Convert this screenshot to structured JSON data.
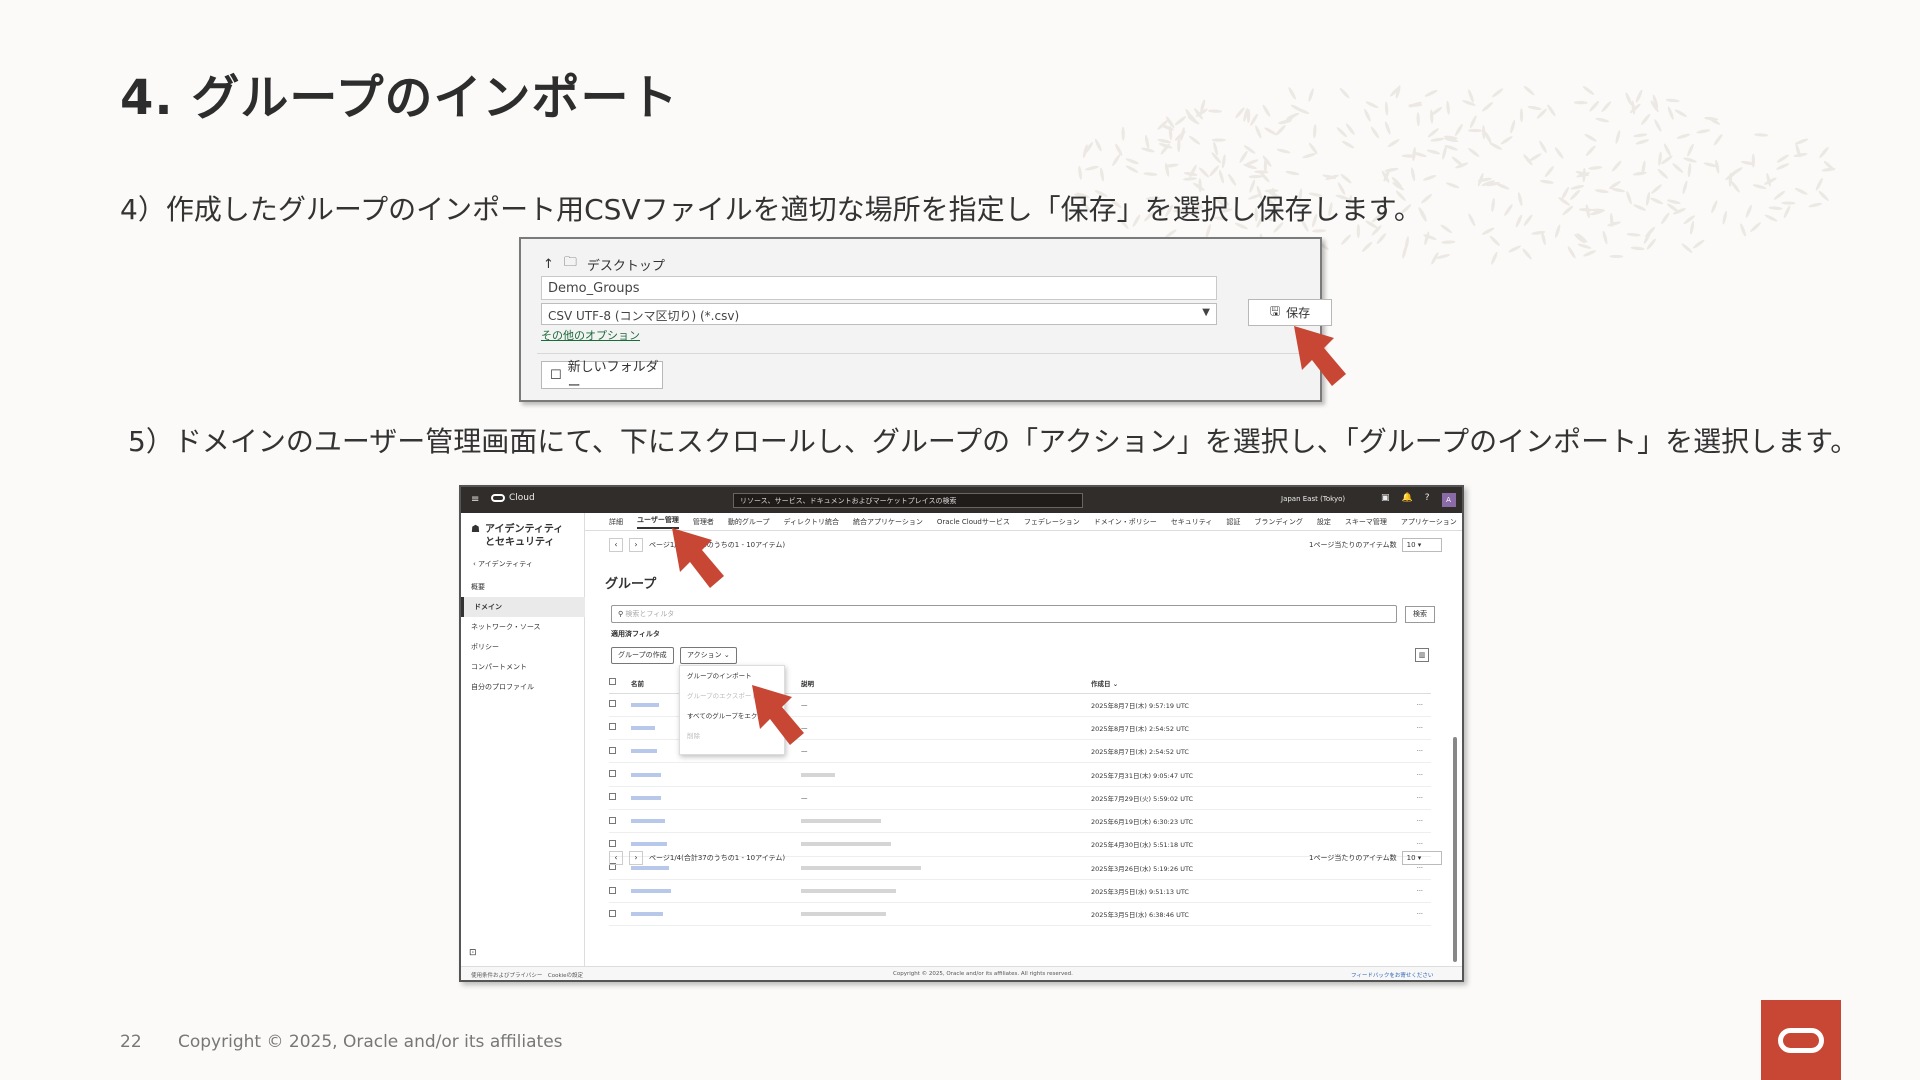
{
  "slide": {
    "title": "4. グループのインポート",
    "step4": "4）作成したグループのインポート用CSVファイルを適切な場所を指定し「保存」を選択し保存します。",
    "step5": "5）ドメインのユーザー管理画面にて、下にスクロールし、グループの「アクション」を選択し、「グループのインポート」を選択します。",
    "page_number": "22",
    "copyright": "Copyright © 2025, Oracle and/or its affiliates",
    "accent_color": "#c74634"
  },
  "save_dialog": {
    "up_symbol": "↑",
    "folder_symbol": "🗀",
    "location": "デスクトップ",
    "file_name": "Demo_Groups",
    "file_type": "CSV UTF-8 (コンマ区切り) (*.csv)",
    "dropdown_symbol": "▼",
    "more_options": "その他のオプション",
    "save_symbol": "🖫",
    "save_label": "保存",
    "new_folder_symbol": "☐",
    "new_folder_label": "新しいフォルダー"
  },
  "oci": {
    "topbar": {
      "menu_symbol": "≡",
      "brand": "Cloud",
      "search_placeholder": "リソース、サービス、ドキュメントおよびマーケットプレイスの検索",
      "region": "Japan East (Tokyo)",
      "icons": [
        "▣",
        "🔔",
        "?"
      ],
      "avatar": "A"
    },
    "sidebar": {
      "icon": "☗",
      "heading": "アイデンティティとセキュリティ",
      "back": "‹  アイデンティティ",
      "items": [
        "概要",
        "ドメイン",
        "ネットワーク・ソース",
        "ポリシー",
        "コンパートメント",
        "自分のプロファイル"
      ],
      "footer_symbol": "⊡"
    },
    "tabs": [
      "詳細",
      "ユーザー管理",
      "管理者",
      "動的グループ",
      "ディレクトリ統合",
      "統合アプリケーション",
      "Oracle Cloudサービス",
      "フェデレーション",
      "ドメイン・ポリシー",
      "セキュリティ",
      "認証",
      "ブランディング",
      "設定",
      "スキーマ管理",
      "アプリケーション",
      "›"
    ],
    "pager_top": "ページ1/4(合計38のうちの1 - 10アイテム)",
    "pager_bottom": "ページ1/4(合計37のうちの1 - 10アイテム)",
    "pager_prev": "‹",
    "pager_next": "›",
    "per_page_label": "1ページ当たりのアイテム数",
    "per_page_value": "10 ▾",
    "groups_title": "グループ",
    "search_symbol": "⚲",
    "search_placeholder": "検索とフィルタ",
    "search_button": "検索",
    "applied_filters": "適用済フィルタ",
    "create_group": "グループの作成",
    "actions": "アクション ⌄",
    "columns_symbol": "▥",
    "actions_menu": [
      "グループのインポート",
      "グループのエクスポート",
      "すべてのグループをエクスポート",
      "削除"
    ],
    "table": {
      "headers": [
        "名前",
        "説明",
        "作成日 ⌄"
      ],
      "rows": [
        {
          "desc": "—",
          "created": "2025年8月7日(木) 9:57:19 UTC"
        },
        {
          "desc": "—",
          "created": "2025年8月7日(木) 2:54:52 UTC"
        },
        {
          "desc": "—",
          "created": "2025年8月7日(木) 2:54:52 UTC"
        },
        {
          "desc": "",
          "created": "2025年7月31日(木) 9:05:47 UTC"
        },
        {
          "desc": "—",
          "created": "2025年7月29日(火) 5:59:02 UTC"
        },
        {
          "desc": "",
          "created": "2025年6月19日(木) 6:30:23 UTC"
        },
        {
          "desc": "",
          "created": "2025年4月30日(水) 5:51:18 UTC"
        },
        {
          "desc": "",
          "created": "2025年3月26日(水) 5:19:26 UTC"
        },
        {
          "desc": "",
          "created": "2025年3月5日(水) 9:51:13 UTC"
        },
        {
          "desc": "",
          "created": "2025年3月5日(水) 6:38:46 UTC"
        }
      ],
      "row_menu": "···"
    },
    "footer": {
      "left": "使用条件およびプライバシー　Cookieの設定",
      "center": "Copyright © 2025, Oracle and/or its affiliates. All rights reserved.",
      "right": "フィードバックをお寄せください"
    }
  }
}
